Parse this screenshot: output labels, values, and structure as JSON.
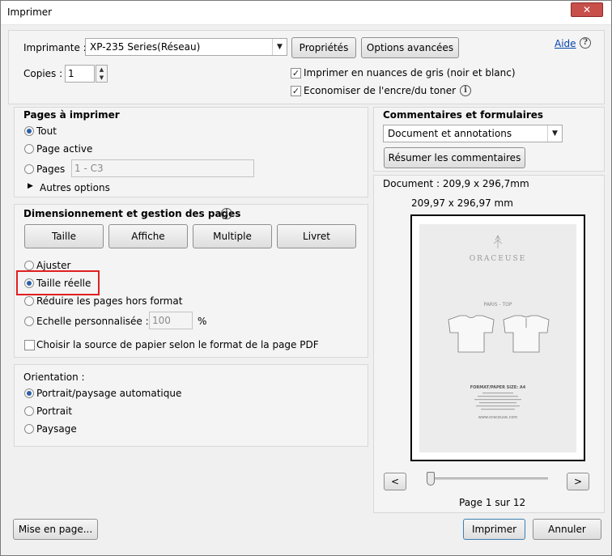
{
  "window": {
    "title": "Imprimer",
    "close_label": "✕"
  },
  "printer": {
    "label": "Imprimante :",
    "selected": "XP-235 Series(Réseau)",
    "properties_button": "Propriétés",
    "advanced_button": "Options avancées",
    "help_link": "Aide",
    "copies_label": "Copies :",
    "copies_value": "1",
    "grayscale_label": "Imprimer en nuances de gris (noir et blanc)",
    "grayscale_checked": true,
    "save_ink_label": "Economiser de l'encre/du toner",
    "save_ink_checked": true
  },
  "pages": {
    "title": "Pages à imprimer",
    "all": "Tout",
    "current": "Page active",
    "range": "Pages",
    "range_value": "1 - C3",
    "more_options": "Autres options",
    "selected": "all"
  },
  "sizing": {
    "title": "Dimensionnement et gestion des pages",
    "buttons": [
      "Taille",
      "Affiche",
      "Multiple",
      "Livret"
    ],
    "fit": "Ajuster",
    "actual_size": "Taille réelle",
    "shrink": "Réduire les pages hors format",
    "custom_scale": "Echelle personnalisée :",
    "custom_scale_value": "100",
    "percent": "%",
    "choose_paper": "Choisir la source de papier selon le format de la page PDF",
    "selected": "actual_size"
  },
  "orientation": {
    "title": "Orientation :",
    "auto": "Portrait/paysage automatique",
    "portrait": "Portrait",
    "landscape": "Paysage",
    "selected": "auto"
  },
  "comments": {
    "title": "Commentaires et formulaires",
    "selected": "Document et annotations",
    "summarize_button": "Résumer les commentaires"
  },
  "preview": {
    "document_size": "Document : 209,9 x 296,7mm",
    "page_size": "209,97 x 296,97 mm",
    "prev": "<",
    "next": ">",
    "page_counter": "Page 1 sur 12",
    "brand": "ORACEUSE",
    "model_line": "PARIS - TOP",
    "format_line": "FORMAT/PAPER SIZE: A4",
    "url": "www.oraceuse.com"
  },
  "footer": {
    "page_setup": "Mise en page...",
    "print": "Imprimer",
    "cancel": "Annuler"
  }
}
